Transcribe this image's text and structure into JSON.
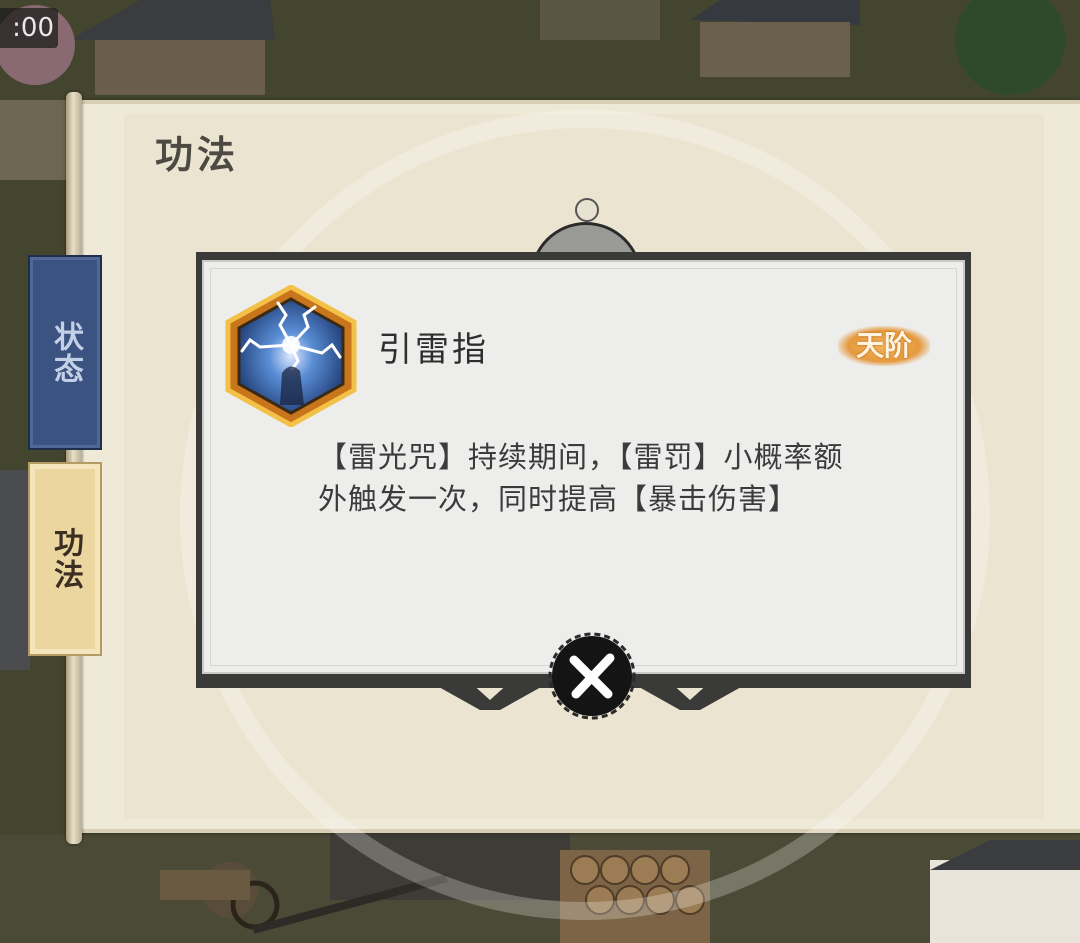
{
  "hud": {
    "timer_text": ":00"
  },
  "panel": {
    "title": "功法"
  },
  "tabs": [
    {
      "label": "状态",
      "active": false
    },
    {
      "label": "功法",
      "active": true
    }
  ],
  "skill": {
    "icon": "lightning-skill-icon",
    "name": "引雷指",
    "rank": "天阶",
    "description": "【雷光咒】持续期间，【雷罚】小概率额外触发一次，同时提高【暴击伤害】"
  },
  "close": {
    "icon": "close-icon"
  },
  "colors": {
    "tab_status_bg": "#3b5380",
    "tab_active_bg": "#ecd6a0",
    "rank_badge": "#e59a3f",
    "scroll_bg": "#efe9d8"
  }
}
